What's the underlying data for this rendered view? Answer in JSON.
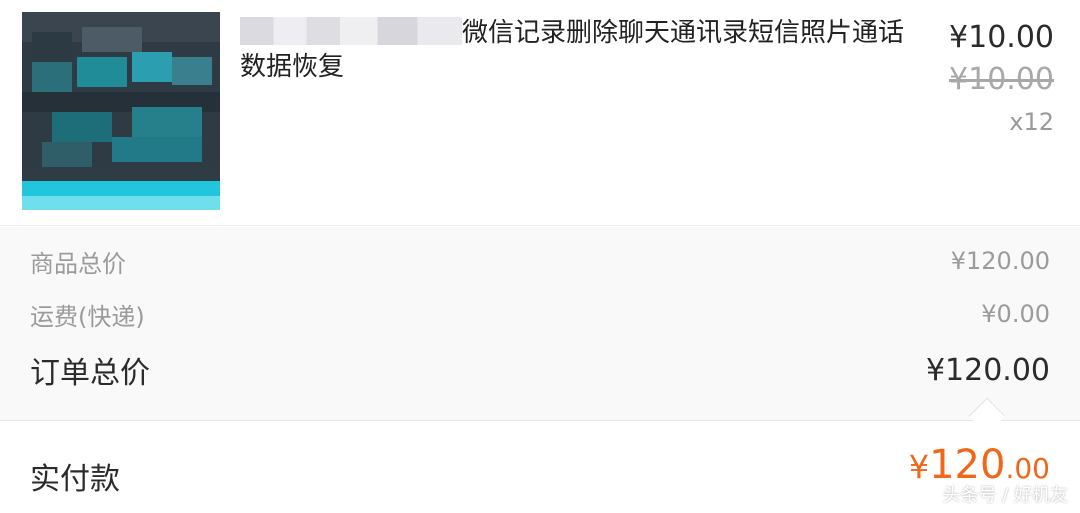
{
  "product": {
    "title": "微信记录删除聊天通讯录短信照片通话数据恢复",
    "price_current": "¥10.00",
    "price_original": "¥10.00",
    "quantity": "x12"
  },
  "summary": {
    "subtotal_label": "商品总价",
    "subtotal_value": "¥120.00",
    "shipping_label": "运费(快递)",
    "shipping_value": "¥0.00",
    "order_total_label": "订单总价",
    "order_total_value": "¥120.00"
  },
  "payment": {
    "label": "实付款",
    "currency": "¥",
    "integer": "120",
    "decimal": ".00"
  },
  "watermark": "头条号 / 好机友",
  "colors": {
    "accent": "#f0661b",
    "muted": "#9b9b9b",
    "divider": "#ececec"
  }
}
